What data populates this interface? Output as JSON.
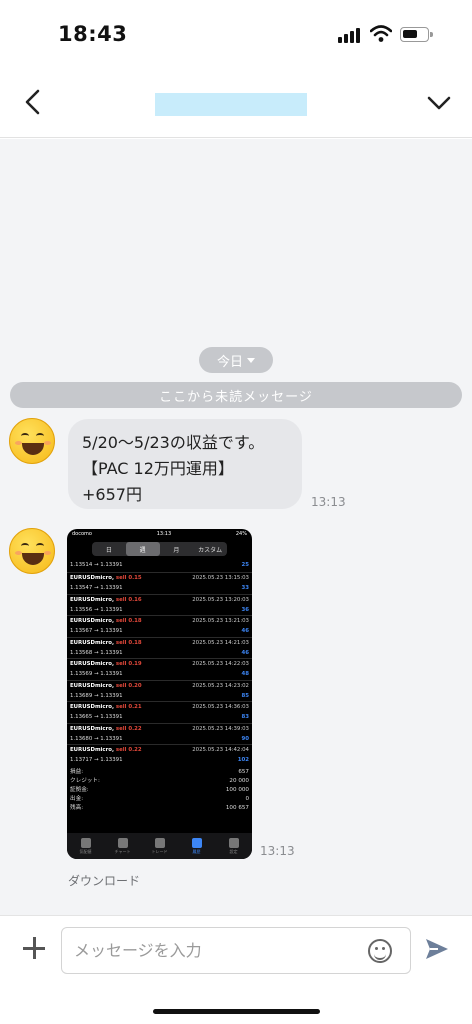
{
  "status_bar": {
    "time": "18:43"
  },
  "header": {
    "title": ""
  },
  "chat": {
    "date_chip": "今日",
    "unread_divider": "ここから未読メッセージ",
    "message1": {
      "lines": [
        "5/20〜5/23の収益です。",
        "【PAC 12万円運用】",
        "+657円"
      ],
      "time": "13:13"
    },
    "message2": {
      "time": "13:13",
      "download_label": "ダウンロード",
      "screenshot": {
        "carrier": "docomo",
        "clock": "13:13",
        "battery": "24%",
        "tabs": [
          "日",
          "週",
          "月",
          "カスタム"
        ],
        "active_tab": "週",
        "first_row": {
          "prices": "1.13514 → 1.13391",
          "profit": "25"
        },
        "trades": [
          {
            "symbol": "EURUSDmicro,",
            "side": "sell 0.15",
            "datetime": "2025.05.23 13:15:03",
            "prices": "1.13547 → 1.13391",
            "profit": "33"
          },
          {
            "symbol": "EURUSDmicro,",
            "side": "sell 0.16",
            "datetime": "2025.05.23 13:20:03",
            "prices": "1.13556 → 1.13391",
            "profit": "36"
          },
          {
            "symbol": "EURUSDmicro,",
            "side": "sell 0.18",
            "datetime": "2025.05.23 13:21:03",
            "prices": "1.13567 → 1.13391",
            "profit": "46"
          },
          {
            "symbol": "EURUSDmicro,",
            "side": "sell 0.18",
            "datetime": "2025.05.23 14:21:03",
            "prices": "1.13568 → 1.13391",
            "profit": "46"
          },
          {
            "symbol": "EURUSDmicro,",
            "side": "sell 0.19",
            "datetime": "2025.05.23 14:22:03",
            "prices": "1.13569 → 1.13391",
            "profit": "48"
          },
          {
            "symbol": "EURUSDmicro,",
            "side": "sell 0.20",
            "datetime": "2025.05.23 14:23:02",
            "prices": "1.13689 → 1.13391",
            "profit": "85"
          },
          {
            "symbol": "EURUSDmicro,",
            "side": "sell 0.21",
            "datetime": "2025.05.23 14:36:03",
            "prices": "1.13665 → 1.13391",
            "profit": "83"
          },
          {
            "symbol": "EURUSDmicro,",
            "side": "sell 0.22",
            "datetime": "2025.05.23 14:39:03",
            "prices": "1.13680 → 1.13391",
            "profit": "90"
          },
          {
            "symbol": "EURUSDmicro,",
            "side": "sell 0.22",
            "datetime": "2025.05.23 14:42:04",
            "prices": "1.13717 → 1.13391",
            "profit": "102"
          }
        ],
        "summary": [
          {
            "label": "損益:",
            "value": "657"
          },
          {
            "label": "クレジット:",
            "value": "20 000"
          },
          {
            "label": "証拠金:",
            "value": "100 000"
          },
          {
            "label": "出金:",
            "value": "0"
          },
          {
            "label": "残高:",
            "value": "100 657"
          }
        ],
        "tabbar": [
          "気配値",
          "チャート",
          "トレード",
          "履歴",
          "設定"
        ],
        "active_tabbar": "履歴"
      }
    }
  },
  "composer": {
    "placeholder": "メッセージを入力"
  },
  "icons": {
    "back": "chevron-left-icon",
    "dropdown": "chevron-down-icon",
    "add": "plus-icon",
    "emoji": "emoji-icon",
    "send": "send-icon"
  },
  "colors": {
    "unread_chip": "#c6c8cc",
    "bubble": "#e6e7ea",
    "chat_bg": "#f3f4f6",
    "title_placeholder": "#c8ecfb"
  }
}
